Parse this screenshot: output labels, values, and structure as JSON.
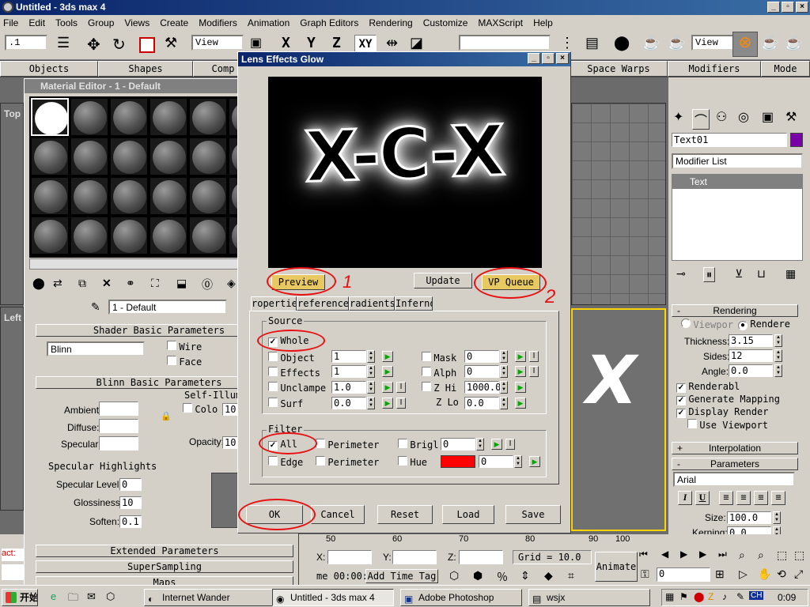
{
  "app": {
    "title": "Untitled - 3ds max 4"
  },
  "menu": [
    "File",
    "Edit",
    "Tools",
    "Group",
    "Views",
    "Create",
    "Modifiers",
    "Animation",
    "Graph Editors",
    "Rendering",
    "Customize",
    "MAXScript",
    "Help"
  ],
  "toolbar": {
    "selection_combo": ".1",
    "refcoord_combo": "View",
    "axis_x": "X",
    "axis_y": "Y",
    "axis_z": "Z",
    "axis_xy": "XY",
    "named_sel": "",
    "view_combo": "View"
  },
  "command_tabs": [
    "Objects",
    "Shapes",
    "Comp",
    "Space Warps",
    "Modifiers",
    "Mode"
  ],
  "material_editor": {
    "title": "Material Editor - 1 - Default",
    "material_name": "1 - Default",
    "shader_header": "Shader Basic Parameters",
    "shader_combo": "Blinn",
    "wire": "Wire",
    "face": "Face",
    "blinn_header": "Blinn Basic Parameters",
    "self_illum": "Self-Illum",
    "color_label": "Colo",
    "color_value": "10",
    "ambient": "Ambient:",
    "diffuse": "Diffuse:",
    "specular": "Specular:",
    "opacity_label": "Opacity:",
    "opacity_value": "10",
    "spec_highlights": "Specular Highlights",
    "spec_level_label": "Specular Level:",
    "spec_level": "0",
    "glossiness_label": "Glossiness:",
    "glossiness": "10",
    "soften_label": "Soften:",
    "soften": "0.1",
    "extended": "Extended Parameters",
    "supersampling": "SuperSampling",
    "maps": "Maps"
  },
  "viewports": {
    "top_label": "Top",
    "left_label": "Left"
  },
  "dialog": {
    "title": "Lens Effects Glow",
    "preview_text": "X-C-X",
    "preview_btn": "Preview",
    "update_btn": "Update",
    "vpqueue_btn": "VP Queue",
    "tabs": [
      "ropertie",
      "reference",
      "radients",
      "Inferno"
    ],
    "source_label": "Source",
    "whole": "Whole",
    "object": "Object",
    "object_val": "1",
    "effects": "Effects",
    "effects_val": "1",
    "unclamp": "Unclampe",
    "unclamp_val": "1.0",
    "surf": "Surf",
    "surf_val": "0.0",
    "mask": "Mask",
    "mask_val": "0",
    "alph": "Alph",
    "alph_val": "0",
    "zhi": "Z Hi",
    "zhi_val": "1000.0",
    "zlo": "Z Lo",
    "zlo_val": "0.0",
    "filter_label": "Filter",
    "all": "All",
    "perimeter1": "Perimeter",
    "bright": "Brigl",
    "bright_val": "0",
    "edge": "Edge",
    "perimeter2": "Perimeter",
    "hue": "Hue",
    "hue_val": "0",
    "hue_color": "#ff0000",
    "ok": "OK",
    "cancel": "Cancel",
    "reset": "Reset",
    "load": "Load",
    "save": "Save",
    "annot1": "1",
    "annot2": "2"
  },
  "right_panel": {
    "object_name": "Text01",
    "object_color": "#7a00a8",
    "modifier_list": "Modifier List",
    "stack_item": "Text",
    "rendering_header": "Rendering",
    "viewport_radio": "Viewpor",
    "renderer_radio": "Rendere",
    "thickness_label": "Thickness:",
    "thickness": "3.15",
    "sides_label": "Sides:",
    "sides": "12",
    "angle_label": "Angle:",
    "angle": "0.0",
    "renderable": "Renderabl",
    "gen_mapping": "Generate Mapping",
    "display_render": "Display Render",
    "use_viewport": "Use Viewport",
    "interp_header": "Interpolation",
    "params_header": "Parameters",
    "font": "Arial",
    "size_label": "Size:",
    "size": "100.0",
    "kerning_label": "Kerning:",
    "kerning": "0.0"
  },
  "status": {
    "ruler": [
      "50",
      "60",
      "70",
      "80",
      "90",
      "100"
    ],
    "x_label": "X:",
    "y_label": "Y:",
    "z_label": "Z:",
    "grid": "Grid = 10.0",
    "time": "me 00:00:",
    "add_time_tag": "Add Time Tag",
    "animate": "Animate",
    "frame": "0",
    "left_text": "act:"
  },
  "taskbar": {
    "start": "开始",
    "items": [
      "Internet Wander",
      "Untitled - 3ds max 4",
      "Adobe Photoshop",
      "wsjx"
    ],
    "clock": "0:09",
    "lang": "CH"
  }
}
